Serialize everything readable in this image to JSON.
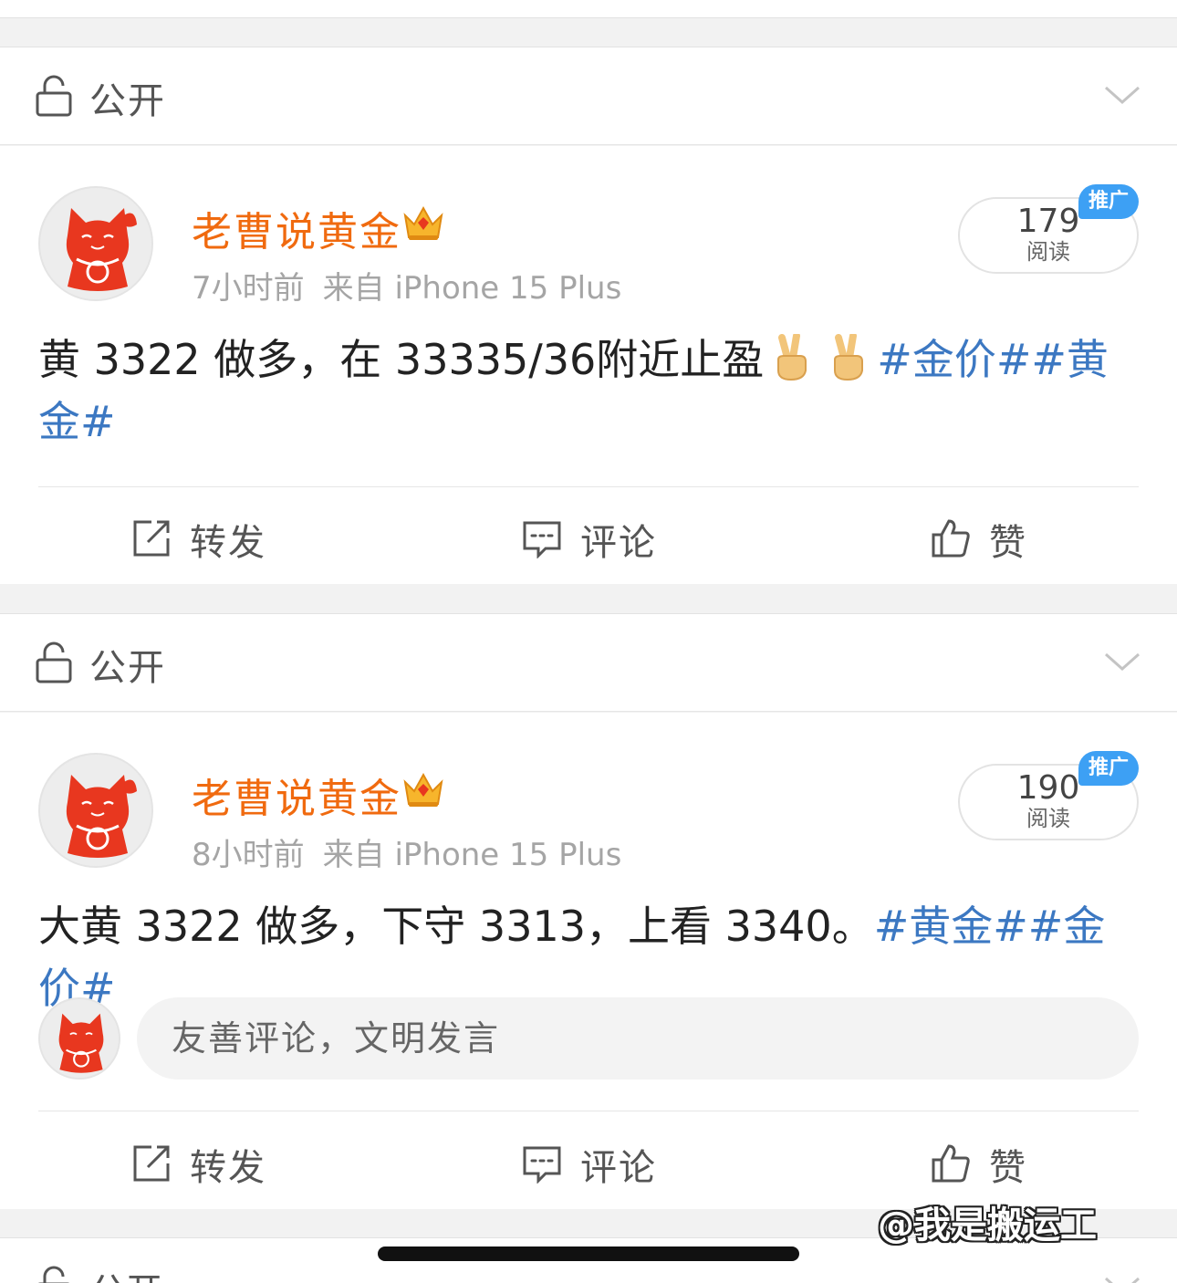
{
  "posts": [
    {
      "visibility": "公开",
      "author": "老曹说黄金",
      "time": "7小时前",
      "source": "来自 iPhone 15 Plus",
      "reads": "179",
      "reads_label": "阅读",
      "promo": "推广",
      "text_before": "黄 3322 做多，在 33335/36附近止盈",
      "tags": "#金价##黄金#",
      "actions": {
        "repost": "转发",
        "comment": "评论",
        "like": "赞"
      }
    },
    {
      "visibility": "公开",
      "author": "老曹说黄金",
      "time": "8小时前",
      "source": "来自 iPhone 15 Plus",
      "reads": "190",
      "reads_label": "阅读",
      "promo": "推广",
      "text_before": "大黄 3322 做多，下守 3313，上看 3340。",
      "tags": "#黄金##金价#",
      "comment_placeholder": "友善评论，文明发言",
      "actions": {
        "repost": "转发",
        "comment": "评论",
        "like": "赞"
      }
    }
  ],
  "next_visibility": "公开",
  "watermark": "@我是搬运工",
  "colors": {
    "author": "#f06a0f",
    "hashtag": "#3c78c2",
    "promo": "#3da0f4"
  }
}
